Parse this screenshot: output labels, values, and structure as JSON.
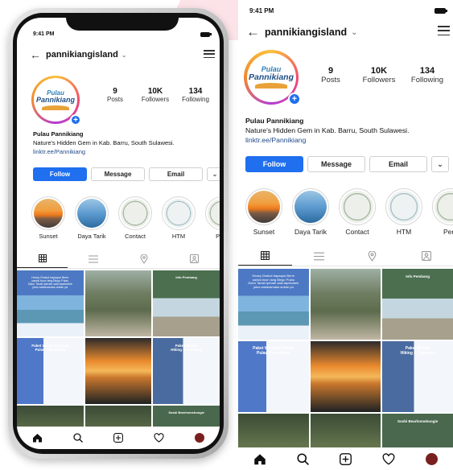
{
  "status": {
    "time": "9:41 PM"
  },
  "profile": {
    "username": "pannikiangisland",
    "logo_top": "Pulau",
    "logo_main": "Pannikiang",
    "stats": [
      {
        "num": "9",
        "label": "Posts"
      },
      {
        "num": "10K",
        "label": "Followers"
      },
      {
        "num": "134",
        "label": "Following"
      }
    ],
    "name": "Pulau Pannikiang",
    "bio": "Nature's Hidden Gem in Kab. Barru, South Sulawesi.",
    "link": "linktr.ee/Pannikiang"
  },
  "buttons": {
    "follow": "Follow",
    "message": "Message",
    "email": "Email"
  },
  "highlights": [
    "Sunset",
    "Daya Tarik",
    "Contact",
    "HTM",
    "Pera"
  ],
  "posts": [
    {
      "title": "Heavy Dhakot bapaqua Berre\npantai boon lang Bingo Pulau\nDaun Tanah Ipenah sala tapekubek\njutus sakanamaka ankan pa",
      "style": "c-blue"
    },
    {
      "title": "",
      "style": "c-woman"
    },
    {
      "title": "Info Pembang",
      "style": "c-green"
    },
    {
      "title": "Paket Wisata Edukasi\nPulau Pannikiang",
      "style": "c-info"
    },
    {
      "title": "",
      "style": "c-sun"
    },
    {
      "title": "Paket Wisata\nHiking & Camping",
      "style": "c-mang"
    },
    {
      "title": "",
      "style": "c-dark"
    },
    {
      "title": "",
      "style": "c-dark"
    },
    {
      "title": "Sosbi Bearhomeboogie",
      "style": "c-dgreen"
    }
  ],
  "colors": {
    "follow_blue": "#1f6fef",
    "link_blue": "#234b89",
    "avatar_dot": "#7a1f1f"
  },
  "icons": {
    "tabs": [
      "grid-icon",
      "list-icon",
      "location-icon",
      "tagged-icon"
    ],
    "nav": [
      "home-icon",
      "search-icon",
      "add-post-icon",
      "heart-icon",
      "profile-avatar"
    ]
  }
}
